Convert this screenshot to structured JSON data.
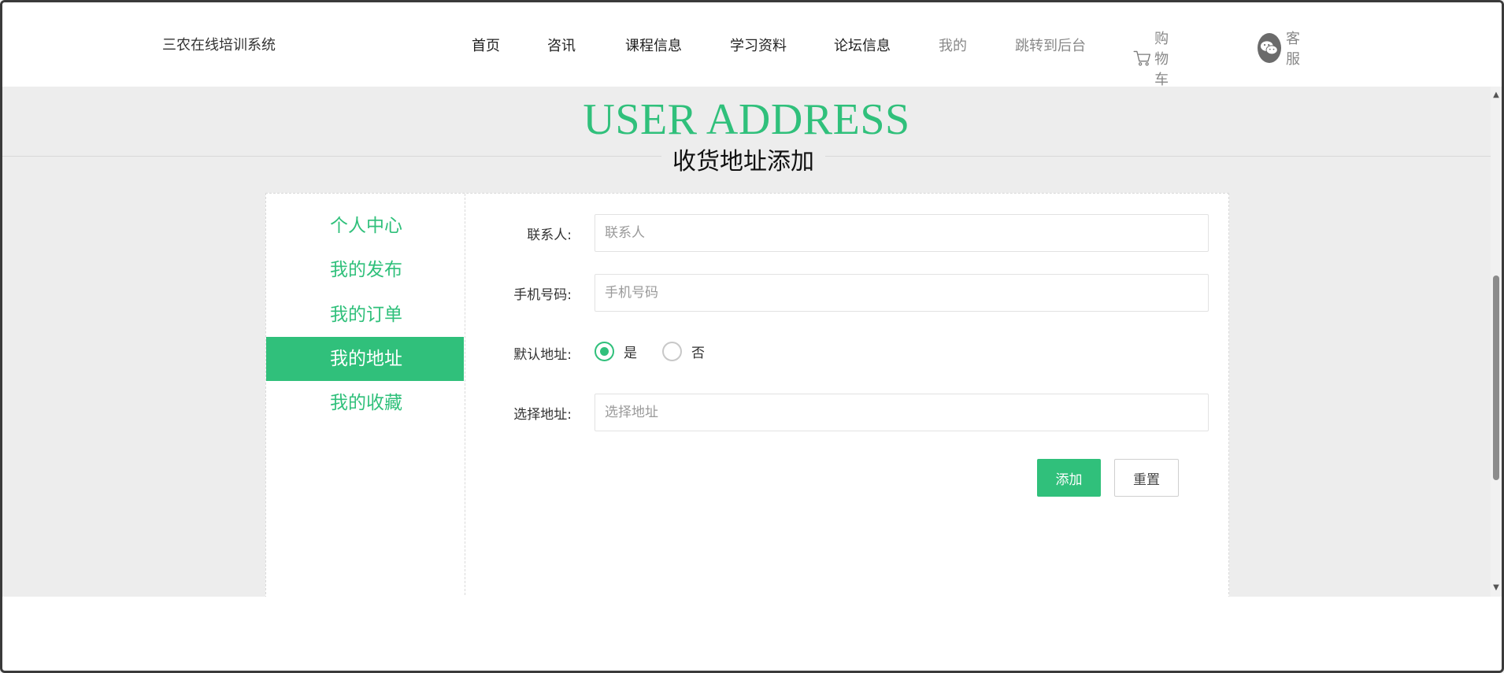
{
  "brand": "三农在线培训系统",
  "nav": {
    "home": "首页",
    "news": "咨讯",
    "course": "课程信息",
    "study": "学习资料",
    "forum": "论坛信息",
    "mine": "我的",
    "admin": "跳转到后台",
    "cart": "购物车",
    "service": "客服"
  },
  "page": {
    "hero": "USER ADDRESS",
    "subtitle": "收货地址添加"
  },
  "sidebar": {
    "items": [
      {
        "label": "个人中心",
        "active": false
      },
      {
        "label": "我的发布",
        "active": false
      },
      {
        "label": "我的订单",
        "active": false
      },
      {
        "label": "我的地址",
        "active": true
      },
      {
        "label": "我的收藏",
        "active": false
      }
    ]
  },
  "form": {
    "contact": {
      "label": "联系人:",
      "placeholder": "联系人",
      "value": ""
    },
    "phone": {
      "label": "手机号码:",
      "placeholder": "手机号码",
      "value": ""
    },
    "default": {
      "label": "默认地址:",
      "yes": "是",
      "no": "否",
      "selected": "是"
    },
    "address": {
      "label": "选择地址:",
      "placeholder": "选择地址",
      "value": ""
    },
    "submit": "添加",
    "reset": "重置"
  },
  "colors": {
    "accent": "#30c07b",
    "background": "#ededed"
  }
}
